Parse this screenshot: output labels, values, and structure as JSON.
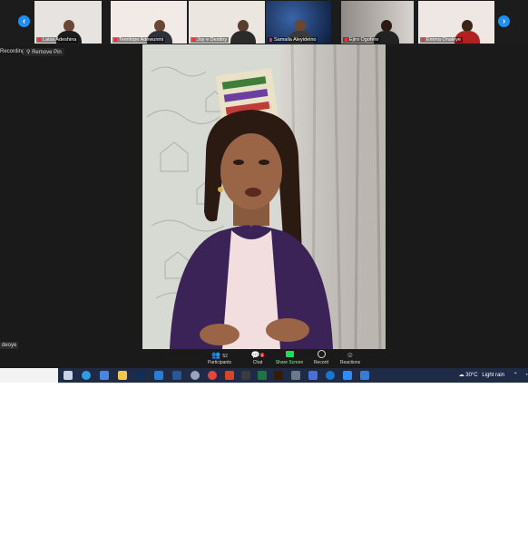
{
  "gallery": {
    "participants": [
      {
        "name": "Laisa Adeshina",
        "bg": "#e6e3e0",
        "shirt": "#1c1c1c"
      },
      {
        "name": "Temitope Adewunmi",
        "bg": "#f1eae6",
        "shirt": "#30323a"
      },
      {
        "name": "Joy e Destiny",
        "bg": "#ece6e1",
        "shirt": "#2b2b2b"
      },
      {
        "name": "Samaila Aleyideino",
        "bg": "#1d3a6a",
        "shirt": "#3a3a3a"
      },
      {
        "name": "Ejiro Ogofere",
        "bg": "#b7b2ad",
        "shirt": "#222222"
      },
      {
        "name": "Emma Onaleye",
        "bg": "#eee7e3",
        "shirt": "#b22020"
      }
    ]
  },
  "status": {
    "recording": "Recording",
    "remove_pin": "Remove Pin",
    "corner_name": "deoye"
  },
  "toolbar": {
    "participants_label": "Participants",
    "participants_count": "52",
    "chat_label": "Chat",
    "chat_badge": "1",
    "share_label": "Share Screen",
    "record_label": "Record",
    "reactions_label": "Reactions"
  },
  "taskbar": {
    "temperature": "30°C",
    "weather": "Light rain"
  },
  "colors": {
    "accent": "#1e8ef5",
    "share_green": "#23d959",
    "taskbar": "#1f2b46"
  }
}
